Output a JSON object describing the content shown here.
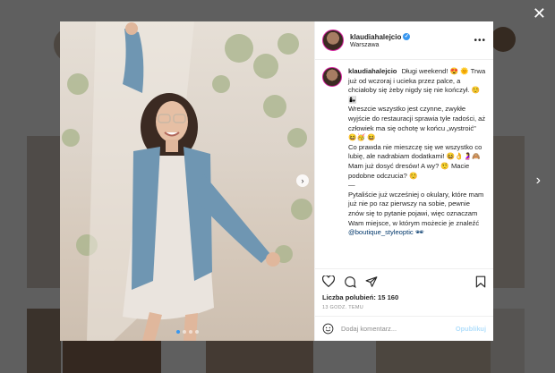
{
  "post": {
    "username": "klaudiahalejcio",
    "location": "Warszawa",
    "caption_paragraphs": [
      "Długi weekend! 😍 🌞 Trwa już od wczoraj i ucieka przez palce, a chciałoby się żeby nigdy się nie kończył. ☺️👩‍👧",
      "Wreszcie wszystko jest czynne, zwykłe wyjście do restauracji sprawia tyle radości, aż człowiek ma się ochotę w końcu „wystroić\" 😆🥳 😆",
      "Co prawda nie mieszczę się we wszystko co lubię, ale nadrabiam dodatkami! 😆👌🤰🙈 Mam już dosyć dresów! A wy? 🤨 Macie podobne odczucia? ☺️",
      "—",
      "Pytaliście już wcześniej o okulary, które mam już nie po raz pierwszy na sobie, pewnie znów się to pytanie pojawi, więc oznaczam Wam miejsce, w którym możecie je znaleźć"
    ],
    "mention": "@boutique_styleoptic 🕶",
    "likes_text": "Liczba polubień: 15 160",
    "time_ago": "13 GODZ. TEMU",
    "comment_placeholder": "Dodaj komentarz...",
    "publish_label": "Opublikuj",
    "more_label": "•••",
    "next_label": "›",
    "slide_index": 1,
    "slide_count": 4
  },
  "background": {
    "close_label": "✕",
    "next_label": "›"
  },
  "icons": [
    "heart-icon",
    "comment-icon",
    "share-icon",
    "bookmark-icon",
    "emoji-icon",
    "verified-icon"
  ],
  "colors": {
    "accent": "#3897f0",
    "publish_disabled": "#b2dffc",
    "text": "#262626",
    "muted": "#8e8e8e"
  }
}
